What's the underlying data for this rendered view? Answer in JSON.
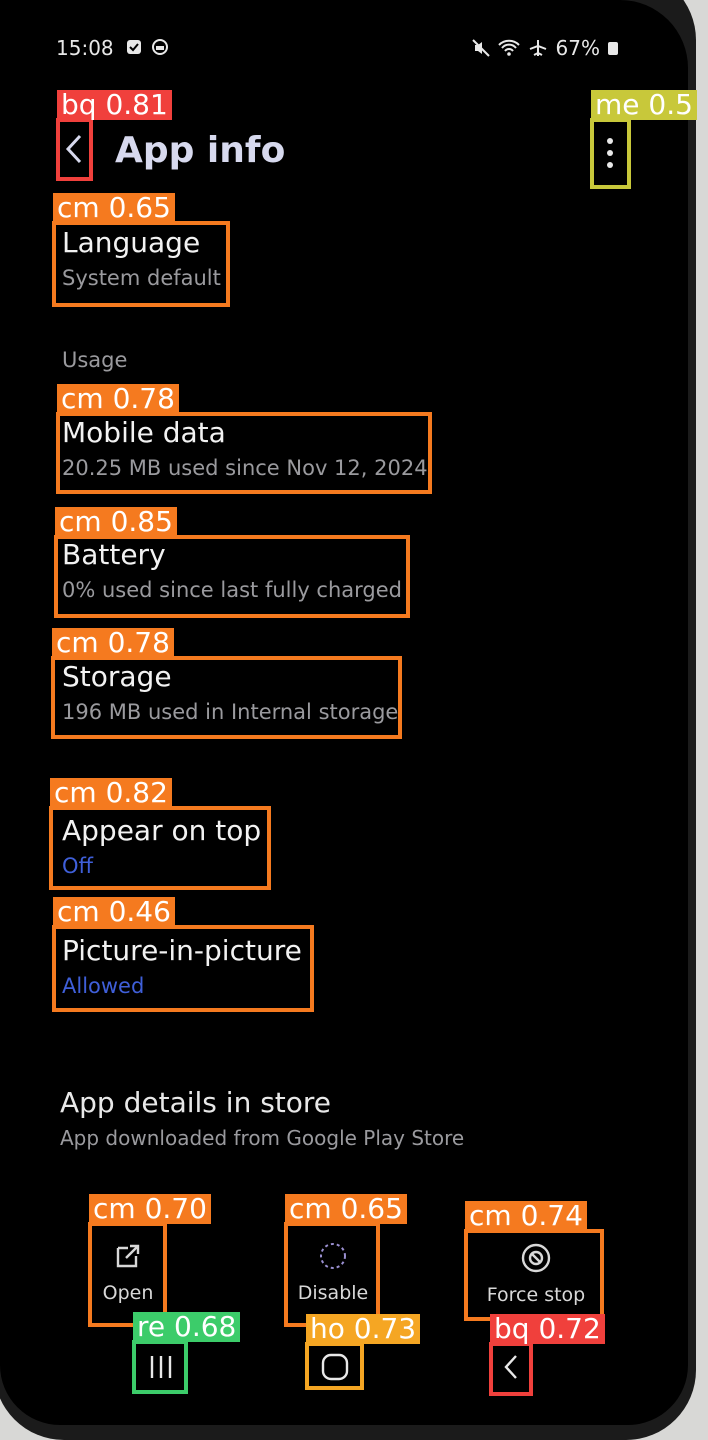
{
  "status_bar": {
    "time": "15:08",
    "battery": "67%"
  },
  "header": {
    "title": "App info"
  },
  "language": {
    "title": "Language",
    "value": "System default"
  },
  "usage_section": {
    "label": "Usage"
  },
  "mobile_data": {
    "title": "Mobile data",
    "value": "20.25 MB used since Nov 12, 2024"
  },
  "battery": {
    "title": "Battery",
    "value": "0% used since last fully charged"
  },
  "storage": {
    "title": "Storage",
    "value": "196 MB used in Internal storage"
  },
  "appear_on_top": {
    "title": "Appear on top",
    "value": "Off"
  },
  "pip": {
    "title": "Picture-in-picture",
    "value": "Allowed"
  },
  "store": {
    "title": "App details in store",
    "subtitle": "App downloaded from Google Play Store"
  },
  "actions": {
    "open": "Open",
    "disable": "Disable",
    "force_stop": "Force stop"
  },
  "detections": [
    {
      "label": "bq 0.81",
      "color": "#f0403c"
    },
    {
      "label": "me 0.5",
      "color": "#c8c83a"
    },
    {
      "label": "cm 0.65",
      "color": "#f57a1f"
    },
    {
      "label": "cm 0.78",
      "color": "#f57a1f"
    },
    {
      "label": "cm 0.85",
      "color": "#f57a1f"
    },
    {
      "label": "cm 0.78",
      "color": "#f57a1f"
    },
    {
      "label": "cm 0.82",
      "color": "#f57a1f"
    },
    {
      "label": "cm 0.46",
      "color": "#f57a1f"
    },
    {
      "label": "cm 0.70",
      "color": "#f57a1f"
    },
    {
      "label": "cm 0.65",
      "color": "#f57a1f"
    },
    {
      "label": "cm 0.74",
      "color": "#f57a1f"
    },
    {
      "label": "re 0.68",
      "color": "#3ccc6a"
    },
    {
      "label": "ho 0.73",
      "color": "#f5a623"
    },
    {
      "label": "bq 0.72",
      "color": "#f0403c"
    }
  ],
  "colors": {
    "accent": "#3f5fd9",
    "background": "#000000"
  }
}
